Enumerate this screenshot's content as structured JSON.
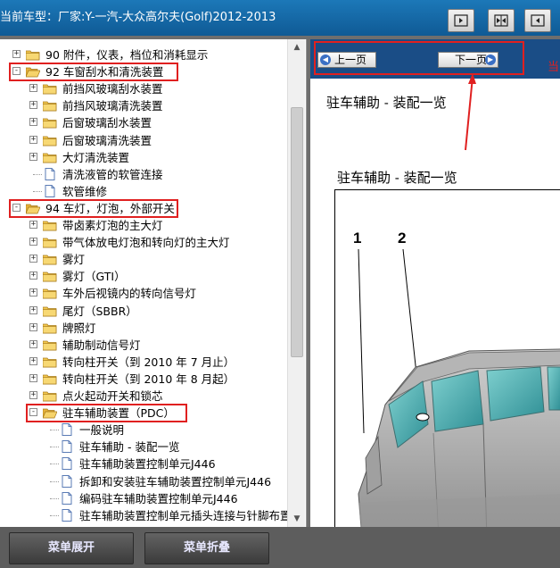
{
  "title_bar": {
    "title": "当前车型：厂家:Y-一汽-大众高尔夫(Golf)2012-2013",
    "buttons": [
      {
        "icon": "panel-left-icon"
      },
      {
        "icon": "panel-split-icon"
      },
      {
        "icon": "panel-right-icon"
      }
    ]
  },
  "tree": {
    "items": [
      {
        "label": "90 附件，仪表，档位和消耗显示",
        "type": "folder",
        "level": 0,
        "expander": "+"
      },
      {
        "label": "92 车窗刮水和清洗装置",
        "type": "folder-open",
        "level": 0,
        "expander": "-",
        "highlighted": true
      },
      {
        "label": "前挡风玻璃刮水装置",
        "type": "folder",
        "level": 1,
        "expander": "+"
      },
      {
        "label": "前挡风玻璃清洗装置",
        "type": "folder",
        "level": 1,
        "expander": "+"
      },
      {
        "label": "后窗玻璃刮水装置",
        "type": "folder",
        "level": 1,
        "expander": "+"
      },
      {
        "label": "后窗玻璃清洗装置",
        "type": "folder",
        "level": 1,
        "expander": "+"
      },
      {
        "label": "大灯清洗装置",
        "type": "folder",
        "level": 1,
        "expander": "+"
      },
      {
        "label": "清洗液管的软管连接",
        "type": "doc",
        "level": 1
      },
      {
        "label": "软管维修",
        "type": "doc",
        "level": 1
      },
      {
        "label": "94 车灯，灯泡，外部开关",
        "type": "folder-open",
        "level": 0,
        "expander": "-",
        "highlighted": true
      },
      {
        "label": "带卤素灯泡的主大灯",
        "type": "folder",
        "level": 1,
        "expander": "+"
      },
      {
        "label": "带气体放电灯泡和转向灯的主大灯",
        "type": "folder",
        "level": 1,
        "expander": "+"
      },
      {
        "label": "雾灯",
        "type": "folder",
        "level": 1,
        "expander": "+"
      },
      {
        "label": "雾灯（GTI）",
        "type": "folder",
        "level": 1,
        "expander": "+"
      },
      {
        "label": "车外后视镜内的转向信号灯",
        "type": "folder",
        "level": 1,
        "expander": "+"
      },
      {
        "label": "尾灯（SBBR）",
        "type": "folder",
        "level": 1,
        "expander": "+"
      },
      {
        "label": "牌照灯",
        "type": "folder",
        "level": 1,
        "expander": "+"
      },
      {
        "label": "辅助制动信号灯",
        "type": "folder",
        "level": 1,
        "expander": "+"
      },
      {
        "label": "转向柱开关（到 2010 年 7 月止）",
        "type": "folder",
        "level": 1,
        "expander": "+"
      },
      {
        "label": "转向柱开关（到 2010 年 8 月起）",
        "type": "folder",
        "level": 1,
        "expander": "+"
      },
      {
        "label": "点火起动开关和锁芯",
        "type": "folder",
        "level": 1,
        "expander": "+"
      },
      {
        "label": "驻车辅助装置（PDC）",
        "type": "folder-open",
        "level": 1,
        "expander": "-",
        "highlighted": true
      },
      {
        "label": "一般说明",
        "type": "doc",
        "level": 2
      },
      {
        "label": "驻车辅助 - 装配一览",
        "type": "doc",
        "level": 2
      },
      {
        "label": "驻车辅助装置控制单元J446",
        "type": "doc",
        "level": 2
      },
      {
        "label": "拆卸和安装驻车辅助装置控制单元J446",
        "type": "doc",
        "level": 2
      },
      {
        "label": "编码驻车辅助装置控制单元J446",
        "type": "doc",
        "level": 2
      },
      {
        "label": "驻车辅助装置控制单元插头连接与针脚布置",
        "type": "doc",
        "level": 2
      }
    ]
  },
  "viewer": {
    "prev_label": "上一页",
    "next_label": "下一页",
    "edge_text": "当",
    "heading": "驻车辅助 - 装配一览",
    "figure_title": "驻车辅助 - 装配一览",
    "callouts": [
      "1",
      "2"
    ]
  },
  "bottom": {
    "expand_label": "菜单展开",
    "collapse_label": "菜单折叠"
  },
  "colors": {
    "titlebar": "#1668a8",
    "navbar": "#1a4d86",
    "highlight": "#e02020",
    "folder": "#f0c14b"
  }
}
